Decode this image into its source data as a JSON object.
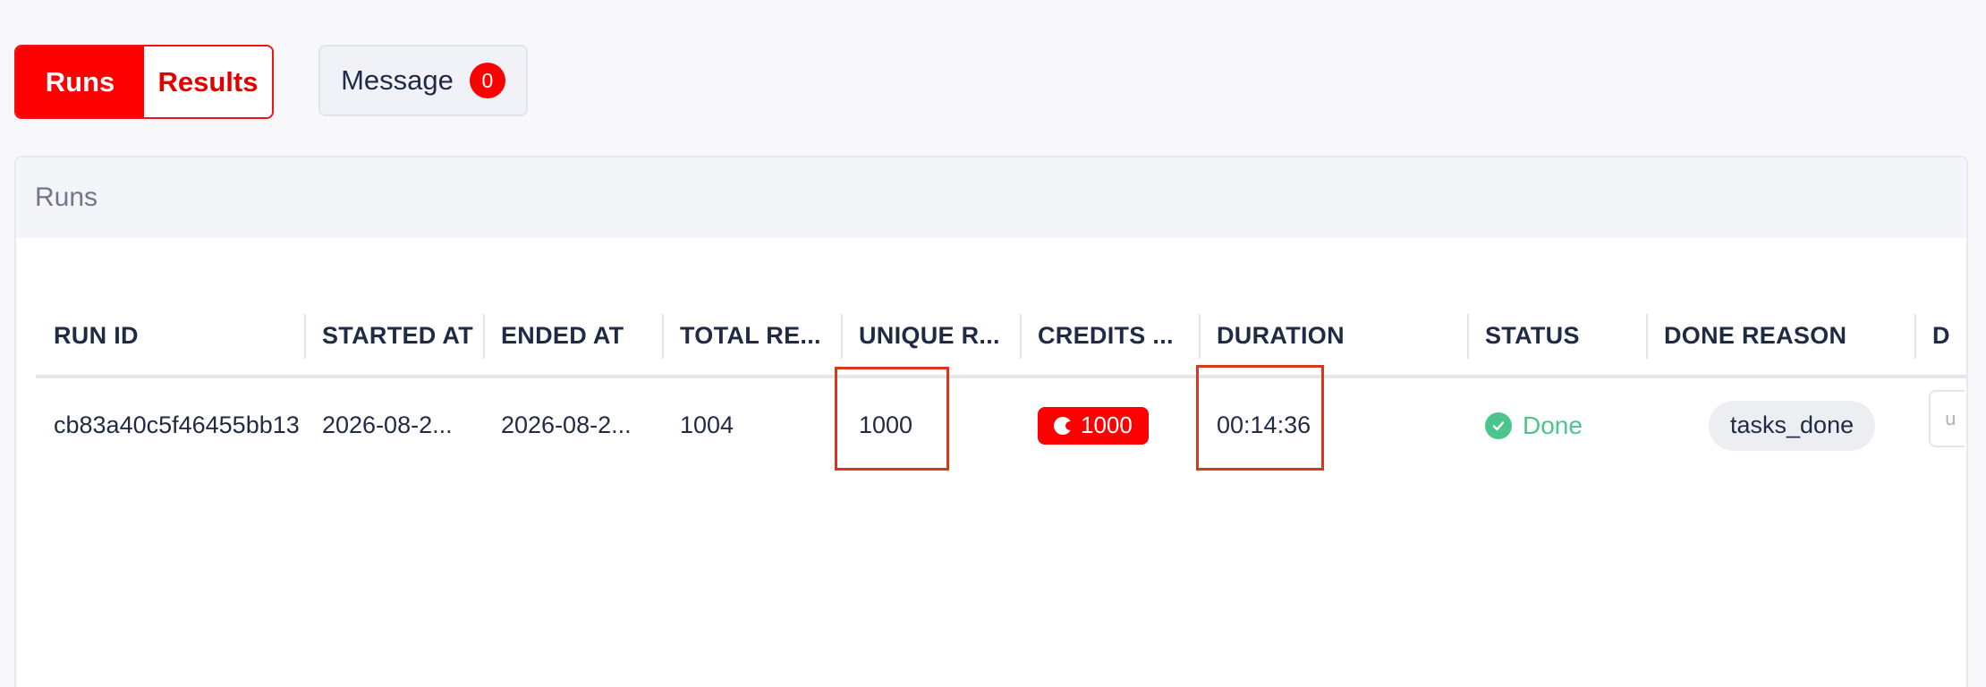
{
  "tabs": {
    "runs_label": "Runs",
    "results_label": "Results"
  },
  "message": {
    "label": "Message",
    "count": "0"
  },
  "card": {
    "title": "Runs"
  },
  "table": {
    "columns": [
      "RUN ID",
      "STARTED AT",
      "ENDED AT",
      "TOTAL RE...",
      "UNIQUE R...",
      "CREDITS ...",
      "DURATION",
      "STATUS",
      "DONE REASON",
      "D"
    ],
    "rows": [
      {
        "run_id": "cb83a40c5f46455bb13",
        "started_at": "2026-08-2...",
        "ended_at": "2026-08-2...",
        "total_requests": "1004",
        "unique_requests": "1000",
        "credits": "1000",
        "duration": "00:14:36",
        "status": "Done",
        "done_reason": "tasks_done",
        "extra": "u"
      }
    ]
  },
  "colors": {
    "accent": "#ff0000",
    "success": "#4cc58d",
    "highlight": "#d9381e"
  },
  "icons": {
    "credits": "coin-icon",
    "status": "check-circle-icon"
  }
}
